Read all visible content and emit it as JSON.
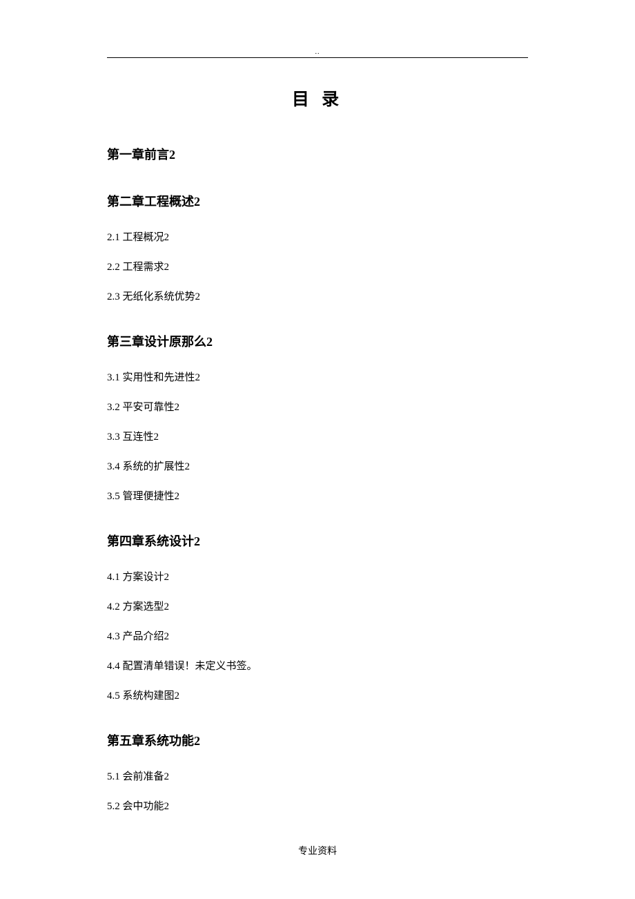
{
  "header_mark": "..",
  "title": "目 录",
  "footer": "专业资料",
  "toc": {
    "chapters": [
      {
        "label": "第一章前言",
        "page": "2",
        "subs": []
      },
      {
        "label": "第二章工程概述",
        "page": "2",
        "subs": [
          {
            "num": "2.1",
            "label": " 工程概况",
            "page": "2"
          },
          {
            "num": "2.2",
            "label": " 工程需求",
            "page": "2"
          },
          {
            "num": "2.3",
            "label": " 无纸化系统优势",
            "page": "2"
          }
        ]
      },
      {
        "label": "第三章设计原那么",
        "page": "2",
        "subs": [
          {
            "num": "3.1",
            "label": " 实用性和先进性",
            "page": "2"
          },
          {
            "num": "3.2",
            "label": " 平安可靠性",
            "page": "2"
          },
          {
            "num": "3.3",
            "label": " 互连性",
            "page": "2"
          },
          {
            "num": "3.4",
            "label": " 系统的扩展性",
            "page": "2"
          },
          {
            "num": "3.5",
            "label": " 管理便捷性",
            "page": "2"
          }
        ]
      },
      {
        "label": "第四章系统设计",
        "page": "2",
        "subs": [
          {
            "num": "4.1",
            "label": " 方案设计",
            "page": "2"
          },
          {
            "num": "4.2",
            "label": " 方案选型",
            "page": "2"
          },
          {
            "num": "4.3",
            "label": " 产品介绍",
            "page": "2"
          },
          {
            "num": "4.4",
            "label": " 配置清单",
            "error": "错误！未定义书签。"
          },
          {
            "num": "4.5",
            "label": " 系统构建图",
            "page": "2"
          }
        ]
      },
      {
        "label": "第五章系统功能",
        "page": "2",
        "subs": [
          {
            "num": "5.1",
            "label": " 会前准备",
            "page": "2"
          },
          {
            "num": "5.2",
            "label": " 会中功能",
            "page": "2"
          }
        ]
      }
    ]
  }
}
